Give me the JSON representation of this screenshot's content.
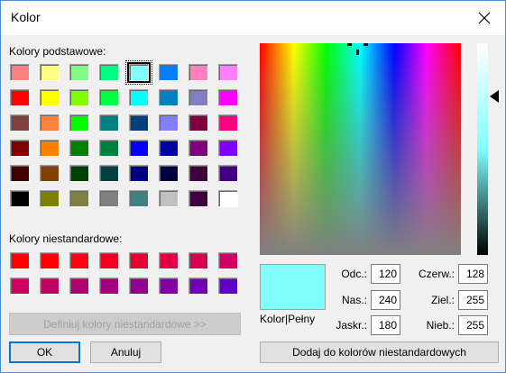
{
  "window": {
    "title": "Kolor"
  },
  "basic_colors": {
    "label": "Kolory podstawowe:",
    "colors": [
      "#ff8080",
      "#ffff80",
      "#80ff80",
      "#00ff80",
      "#80ffff",
      "#0080ff",
      "#ff80c0",
      "#ff80ff",
      "#ff0000",
      "#ffff00",
      "#80ff00",
      "#00ff40",
      "#00ffff",
      "#0080c0",
      "#8080c0",
      "#ff00ff",
      "#804040",
      "#ff8040",
      "#00ff00",
      "#008080",
      "#004080",
      "#8080ff",
      "#800040",
      "#ff0080",
      "#800000",
      "#ff8000",
      "#008000",
      "#008040",
      "#0000ff",
      "#0000a0",
      "#800080",
      "#8000ff",
      "#400000",
      "#804000",
      "#004000",
      "#004040",
      "#000080",
      "#000040",
      "#400040",
      "#400080",
      "#000000",
      "#808000",
      "#808040",
      "#808080",
      "#408080",
      "#c0c0c0",
      "#400040",
      "#ffffff"
    ],
    "selected_index": 4
  },
  "custom_colors": {
    "label": "Kolory niestandardowe:",
    "colors": [
      "#ff0000",
      "#ff0000",
      "#ff0010",
      "#f00020",
      "#e80030",
      "#e00040",
      "#d80050",
      "#d00060",
      "#d00060",
      "#c00060",
      "#b00070",
      "#a00080",
      "#900090",
      "#8000a0",
      "#7000b0",
      "#6000c0"
    ]
  },
  "buttons": {
    "define": "Definiuj kolory niestandardowe >>",
    "ok": "OK",
    "cancel": "Anuluj",
    "add": "Dodaj do kolorów niestandardowych"
  },
  "fields": {
    "hue": {
      "label": "Odc.:",
      "value": "120"
    },
    "sat": {
      "label": "Nas.:",
      "value": "240"
    },
    "lum": {
      "label": "Jaskr.:",
      "value": "180"
    },
    "red": {
      "label": "Czerw.:",
      "value": "128"
    },
    "green": {
      "label": "Ziel.:",
      "value": "255"
    },
    "blue": {
      "label": "Nieb.:",
      "value": "255"
    }
  },
  "preview": {
    "label": "Kolor|Pełny",
    "color": "#80ffff"
  }
}
